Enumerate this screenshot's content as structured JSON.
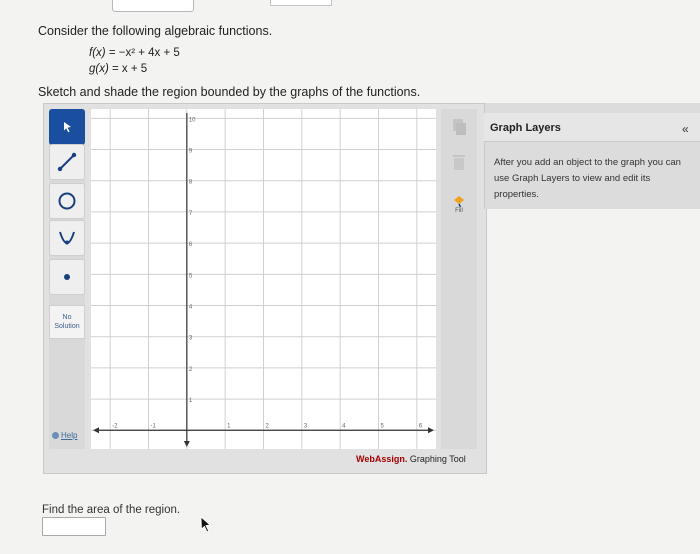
{
  "question": {
    "intro": "Consider the following algebraic functions.",
    "f_name": "f(x)",
    "f_expr": "= −x² + 4x + 5",
    "g_name": "g(x)",
    "g_expr": "= x + 5",
    "instruction": "Sketch and shade the region bounded by the graphs of the functions."
  },
  "tools": {
    "no_solution_line1": "No",
    "no_solution_line2": "Solution",
    "help": "Help",
    "fill": "Fill"
  },
  "graph": {
    "x_ticks": [
      "-2",
      "-1",
      "1",
      "2",
      "3",
      "4",
      "5",
      "6"
    ],
    "y_ticks": [
      "10",
      "9",
      "8",
      "7",
      "6",
      "5",
      "4",
      "3",
      "2",
      "1"
    ]
  },
  "brand": {
    "name": "WebAssign.",
    "suffix": " Graphing Tool"
  },
  "layers": {
    "title": "Graph Layers",
    "collapse": "«",
    "message": "After you add an object to the graph you can use Graph Layers to view and edit its properties."
  },
  "answer": {
    "label": "Find the area of the region.",
    "value": ""
  },
  "colors": {
    "active_tool": "#1a4f9f",
    "brand_red": "#a40000"
  }
}
